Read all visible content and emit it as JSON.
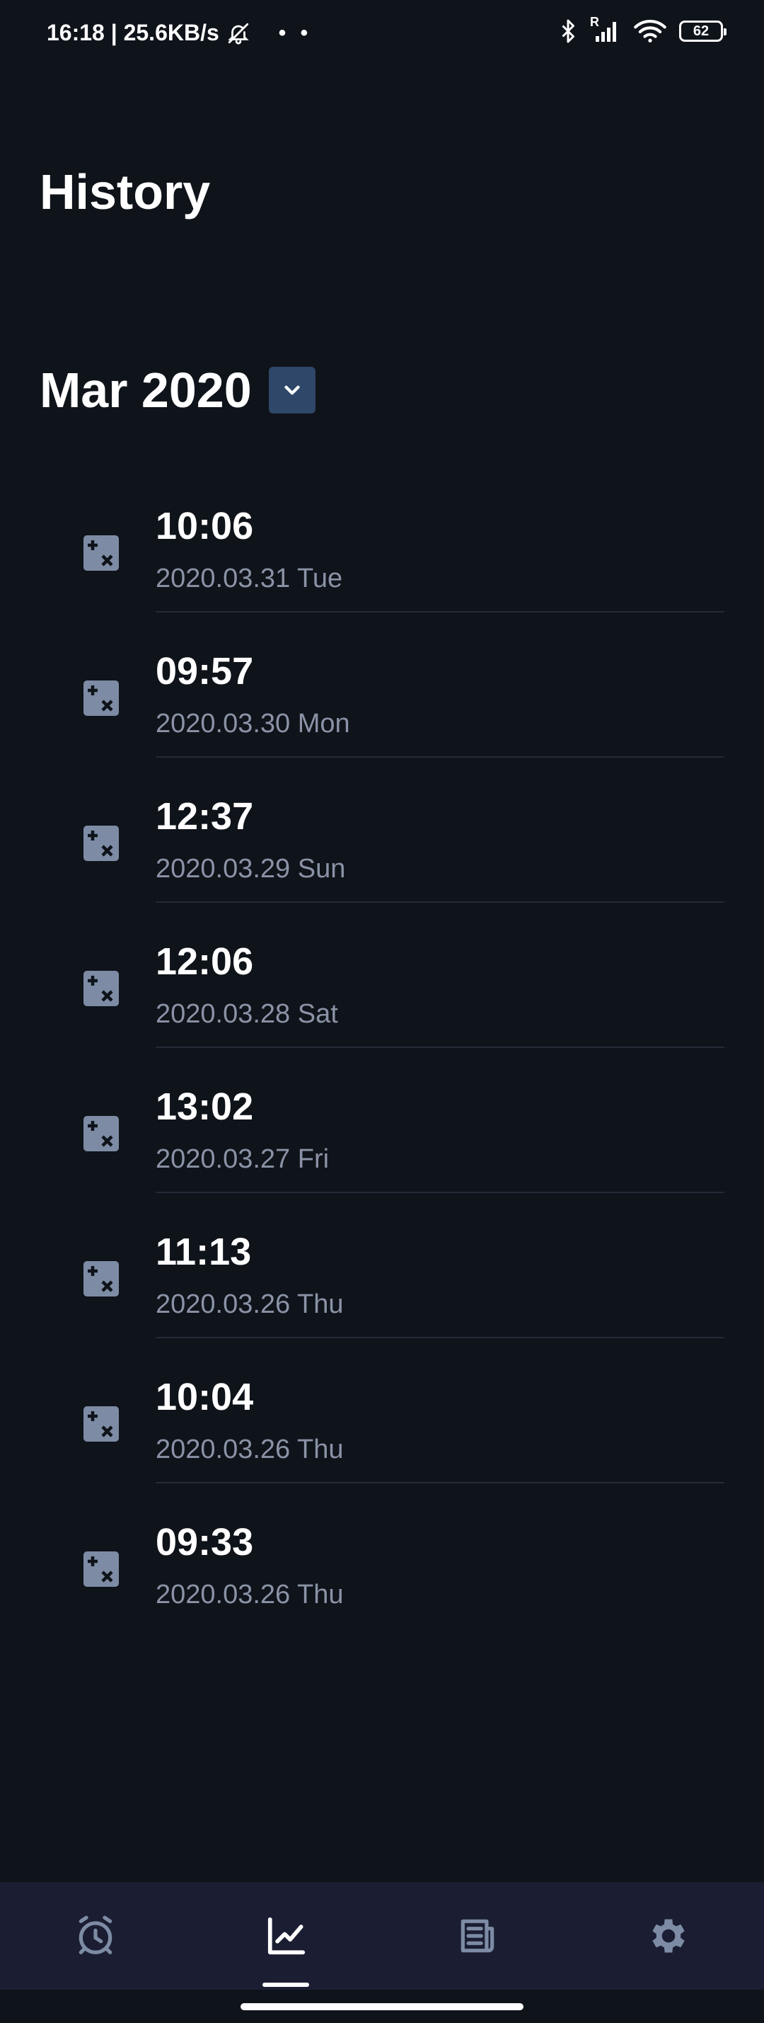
{
  "status_bar": {
    "time_speed": "16:18 | 25.6KB/s",
    "dots": "• •",
    "battery_level": "62",
    "signal_label": "R"
  },
  "header": {
    "title": "History"
  },
  "month_selector": {
    "label": "Mar 2020"
  },
  "history": {
    "items": [
      {
        "time": "10:06",
        "date": "2020.03.31 Tue"
      },
      {
        "time": "09:57",
        "date": "2020.03.30 Mon"
      },
      {
        "time": "12:37",
        "date": "2020.03.29 Sun"
      },
      {
        "time": "12:06",
        "date": "2020.03.28 Sat"
      },
      {
        "time": "13:02",
        "date": "2020.03.27 Fri"
      },
      {
        "time": "11:13",
        "date": "2020.03.26 Thu"
      },
      {
        "time": "10:04",
        "date": "2020.03.26 Thu"
      },
      {
        "time": "09:33",
        "date": "2020.03.26 Thu"
      }
    ]
  },
  "nav": {
    "items": [
      {
        "icon": "alarm-clock-icon",
        "active": false
      },
      {
        "icon": "chart-line-icon",
        "active": true
      },
      {
        "icon": "newspaper-icon",
        "active": false
      },
      {
        "icon": "gear-icon",
        "active": false
      }
    ]
  },
  "colors": {
    "background": "#0f131a",
    "nav_background": "#1b1e33",
    "accent": "#2f4768",
    "muted_text": "#8a93a6",
    "icon_tile": "#7d8ca4"
  }
}
